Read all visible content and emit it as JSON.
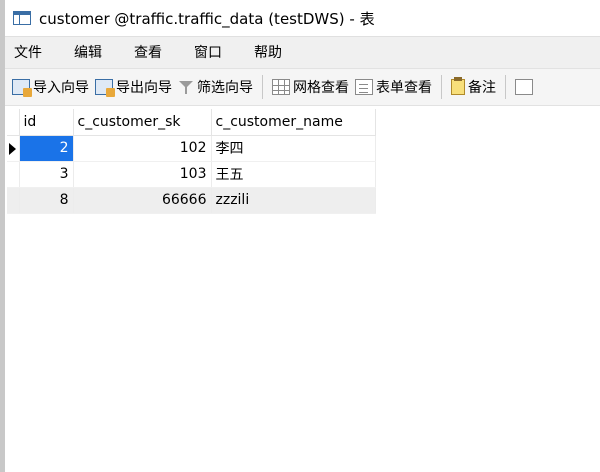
{
  "window": {
    "title": "customer @traffic.traffic_data (testDWS) - 表"
  },
  "menu": {
    "items": [
      "文件",
      "编辑",
      "查看",
      "窗口",
      "帮助"
    ]
  },
  "toolbar": {
    "buttons": [
      {
        "label": "导入向导",
        "icon": "import-wizard-icon"
      },
      {
        "label": "导出向导",
        "icon": "export-wizard-icon"
      },
      {
        "label": "筛选向导",
        "icon": "filter-icon"
      },
      {
        "label": "网格查看",
        "icon": "grid-view-icon"
      },
      {
        "label": "表单查看",
        "icon": "form-view-icon"
      },
      {
        "label": "备注",
        "icon": "note-icon"
      }
    ]
  },
  "table": {
    "columns": [
      "id",
      "c_customer_sk",
      "c_customer_name"
    ],
    "rows": [
      {
        "id": "2",
        "sk": "102",
        "name": "李四",
        "current": true,
        "selected_cell": "id"
      },
      {
        "id": "3",
        "sk": "103",
        "name": "王五",
        "current": false
      },
      {
        "id": "8",
        "sk": "66666",
        "name": "zzzili",
        "current": false
      }
    ]
  },
  "colors": {
    "selection": "#1a73e8",
    "alt_row": "#eeeeee",
    "menubar": "#f0f0f0"
  }
}
